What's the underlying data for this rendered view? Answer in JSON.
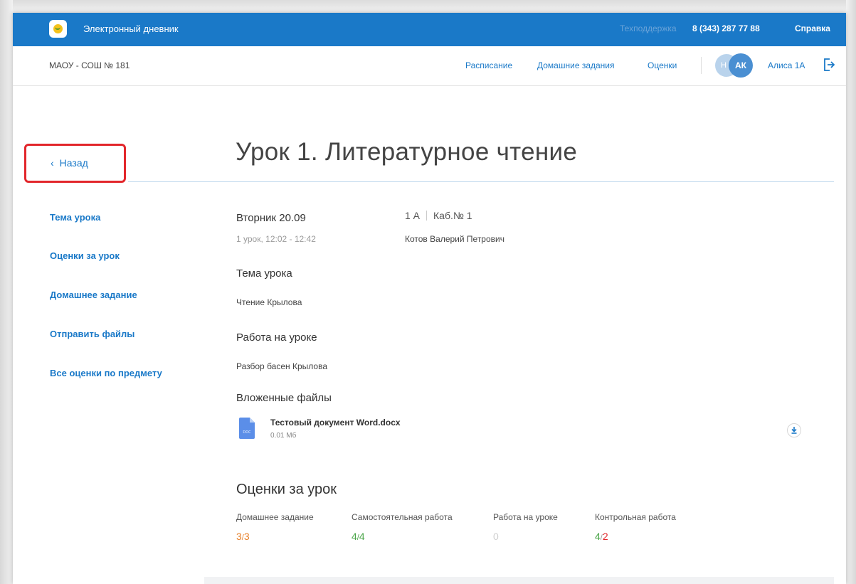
{
  "header": {
    "app_title": "Электронный дневник",
    "support_label": "Техподдержка",
    "support_phone": "8 (343) 287 77 88",
    "help": "Справка"
  },
  "navbar": {
    "school": "МАОУ - СОШ № 181",
    "links": [
      "Расписание",
      "Домашние задания",
      "Оценки"
    ],
    "avatar_back_initial": "Н",
    "avatar_initials": "АК",
    "user_name": "Алиса 1А"
  },
  "back": {
    "label": "Назад",
    "chevron": "‹"
  },
  "title": "Урок 1. Литературное чтение",
  "sidebar": {
    "items": [
      "Тема урока",
      "Оценки за урок",
      "Домашнее задание",
      "Отправить файлы",
      "Все оценки по предмету"
    ]
  },
  "lesson": {
    "day": "Вторник 20.09",
    "time": "1 урок,  12:02 - 12:42",
    "class": "1 А",
    "room": "Каб.№ 1",
    "teacher": "Котов Валерий Петрович"
  },
  "topic": {
    "heading": "Тема урока",
    "text": "Чтение Крылова"
  },
  "classwork": {
    "heading": "Работа на уроке",
    "text": "Разбор басен Крылова"
  },
  "attachments": {
    "heading": "Вложенные файлы",
    "files": [
      {
        "name": "Тестовый документ Word.docx",
        "size": "0.01 Мб",
        "type_label": "DOC"
      }
    ]
  },
  "grades": {
    "heading": "Оценки за урок",
    "items": [
      {
        "category": "Домашнее задание",
        "mark": "3",
        "weight": "3",
        "mark_color": "#e8822c",
        "weight_color": "#e8822c"
      },
      {
        "category": "Самостоятельная работа",
        "mark": "4",
        "weight": "4",
        "mark_color": "#4aa548",
        "weight_color": "#4aa548"
      },
      {
        "category": "Работа на уроке",
        "mark": "0",
        "weight": "",
        "mark_color": "#cfcfcf",
        "weight_color": "#cfcfcf"
      },
      {
        "category": "Контрольная работа",
        "mark": "4",
        "weight": "2",
        "mark_color": "#4aa548",
        "weight_color": "#e2262b"
      }
    ]
  },
  "colors": {
    "brand_blue": "#1a79c8",
    "highlight_red": "#e2262b"
  }
}
